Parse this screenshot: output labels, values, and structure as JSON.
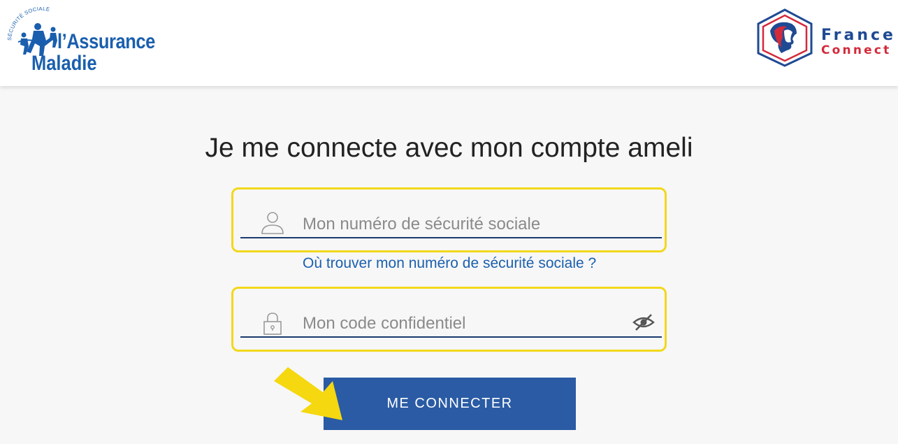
{
  "header": {
    "brand_left": {
      "tagline": "SÉCURITÉ SOCIALE",
      "line1": "l’Assurance",
      "line2": "Maladie"
    },
    "brand_right": {
      "line1": "France",
      "line2": "Connect"
    }
  },
  "main": {
    "title": "Je me connecte avec mon compte ameli",
    "ssn_field": {
      "placeholder": "Mon numéro de sécurité sociale",
      "icon": "user-icon"
    },
    "help_link": "Où trouver mon numéro de sécurité sociale ?",
    "password_field": {
      "placeholder": "Mon code confidentiel",
      "icon": "lock-icon",
      "toggle_icon": "eye-slash-icon"
    },
    "submit_label": "ME CONNECTER"
  },
  "colors": {
    "brand_blue": "#1a5fae",
    "button_blue": "#2a5ba4",
    "highlight_yellow": "#f2d81b",
    "fc_red": "#d32a3b"
  }
}
